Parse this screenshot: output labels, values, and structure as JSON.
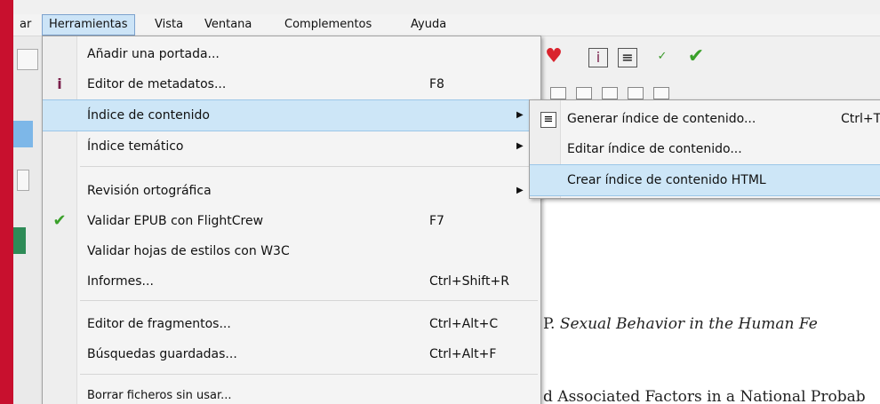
{
  "menubar": {
    "items": [
      "ar",
      "Herramientas",
      "Vista",
      "Ventana",
      "Complementos",
      "Ayuda"
    ]
  },
  "menu": {
    "items": [
      {
        "label": "Añadir una portada...",
        "shortcut": "",
        "icon": ""
      },
      {
        "label": "Editor de metadatos...",
        "shortcut": "F8",
        "icon": "metadata-icon"
      },
      {
        "label": "Índice de contenido",
        "shortcut": "",
        "icon": "",
        "submenu": true
      },
      {
        "label": "Índice temático",
        "shortcut": "",
        "icon": "",
        "submenu": true
      },
      {
        "label": "Revisión ortográfica",
        "shortcut": "",
        "icon": "",
        "submenu": true
      },
      {
        "label": "Validar EPUB con FlightCrew",
        "shortcut": "F7",
        "icon": "checkmark-icon"
      },
      {
        "label": "Validar hojas de estilos con W3C",
        "shortcut": "",
        "icon": ""
      },
      {
        "label": "Informes...",
        "shortcut": "Ctrl+Shift+R",
        "icon": ""
      },
      {
        "label": "Editor de fragmentos...",
        "shortcut": "Ctrl+Alt+C",
        "icon": ""
      },
      {
        "label": "Búsquedas guardadas...",
        "shortcut": "Ctrl+Alt+F",
        "icon": ""
      },
      {
        "label": "Borrar ficheros sin usar...",
        "shortcut": "",
        "icon": ""
      }
    ]
  },
  "submenu": {
    "items": [
      {
        "label": "Generar índice de contenido...",
        "shortcut": "Ctrl+T"
      },
      {
        "label": "Editar índice de contenido...",
        "shortcut": ""
      },
      {
        "label": "Crear índice de contenido HTML",
        "shortcut": ""
      }
    ]
  },
  "document": {
    "line1_prefix": "P. ",
    "line1_italic": "Sexual Behavior in the Human Fe",
    "line2": "d Associated Factors in a National Probab"
  },
  "colors": {
    "accent_bar": "#c8102e",
    "highlight": "#cde6f7"
  }
}
